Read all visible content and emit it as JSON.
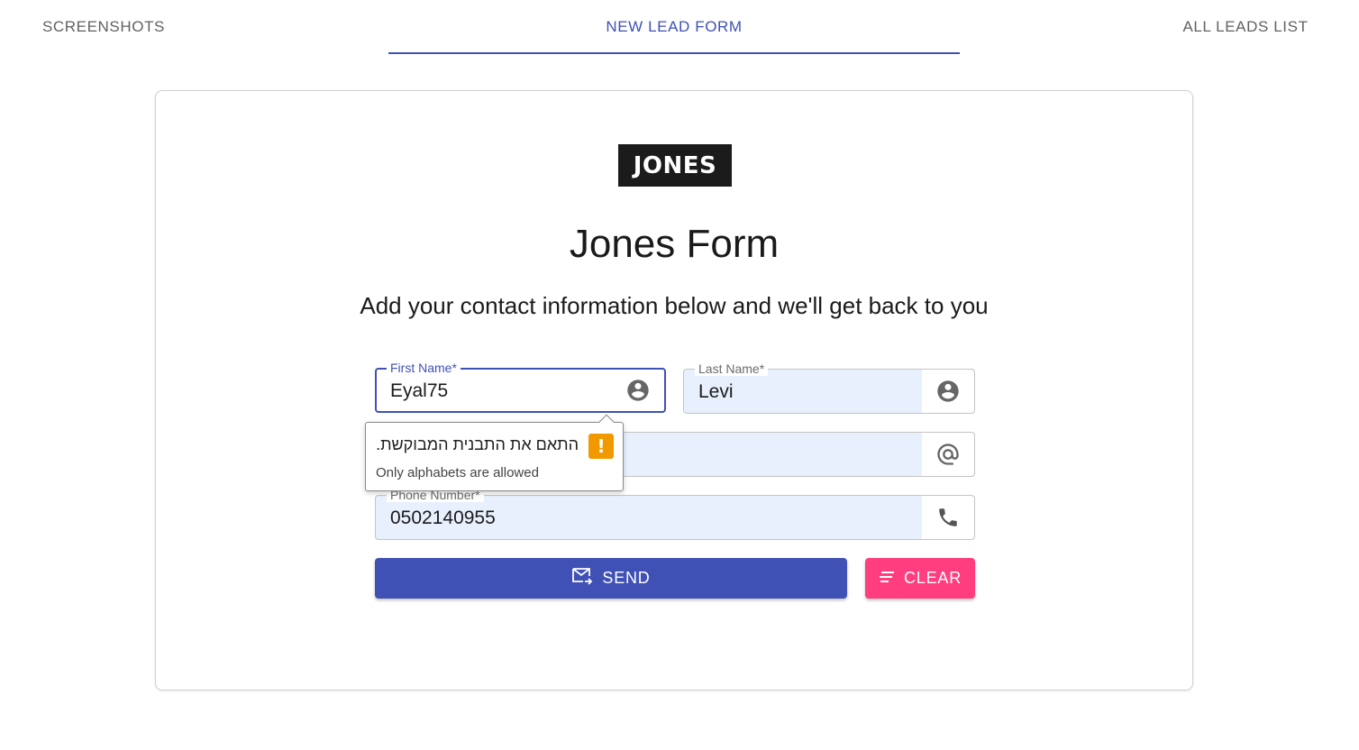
{
  "nav": {
    "items": [
      "Screenshots",
      "New Lead Form",
      "All Leads List"
    ],
    "active_index": 1,
    "accent_color": "#3f51b5"
  },
  "card": {
    "logo_text": "JONES",
    "title": "Jones Form",
    "subtitle": "Add your contact information below and we'll get back to you"
  },
  "form": {
    "first_name": {
      "label": "First Name*",
      "value": "Eyal75",
      "icon": "account-circle-icon"
    },
    "last_name": {
      "label": "Last Name*",
      "value": "Levi",
      "icon": "account-circle-icon"
    },
    "email": {
      "icon": "at-sign-icon"
    },
    "phone": {
      "label": "Phone Number*",
      "value": "0502140955",
      "icon": "phone-icon"
    }
  },
  "buttons": {
    "send_label": "Send",
    "send_icon": "mail-send-icon",
    "send_color": "#3f51b5",
    "clear_label": "Clear",
    "clear_icon": "clear-lines-icon",
    "clear_color": "#ff3d7f"
  },
  "validation": {
    "message": "התאם את התבנית המבוקשת.",
    "hint": "Only alphabets are allowed",
    "icon": "warning-icon",
    "icon_color": "#f29900"
  }
}
